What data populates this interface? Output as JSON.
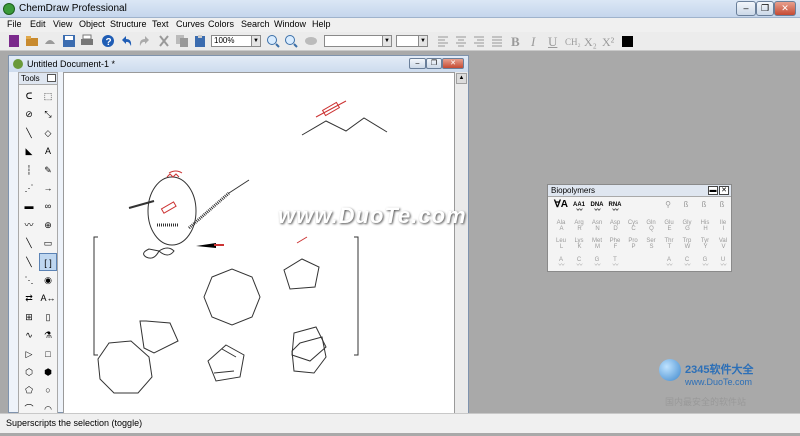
{
  "app": {
    "title": "ChemDraw Professional",
    "window_buttons": {
      "minimize": "–",
      "restore": "❐",
      "close": "✕"
    }
  },
  "menu": [
    "File",
    "Edit",
    "View",
    "Object",
    "Structure",
    "Text",
    "Curves",
    "Colors",
    "Search",
    "Window",
    "Help"
  ],
  "toolbar": {
    "zoom_value": "100%",
    "font_value": "",
    "size_value": "",
    "format": {
      "bold": "B",
      "italic": "I",
      "underline": "U",
      "formula": "CH₂",
      "subscript": "X₂",
      "superscript": "X²"
    },
    "color_swatch": "#000000"
  },
  "document": {
    "title": "Untitled Document-1 *",
    "buttons": {
      "minimize": "–",
      "restore": "❐",
      "close": "✕"
    }
  },
  "tools": {
    "header": "Tools",
    "items": [
      "lasso-icon",
      "marquee-icon",
      "structure-perspective-icon",
      "bond-chain-icon",
      "solid-bond-icon",
      "eraser-icon",
      "wedge-bond-icon",
      "text-icon",
      "dashed-bond-icon",
      "pen-icon",
      "hashed-bond-icon",
      "arrow-icon",
      "bold-bond-icon",
      "orbital-icon",
      "wavy-bond-icon",
      "chemical-symbol-icon",
      "bond-icon",
      "rectangle-icon",
      "bracket-icon",
      "bracket-selected-icon",
      "wedged-hash-icon",
      "stereo-icon",
      "reaction-icon",
      "atom-map-icon",
      "table-icon",
      "tlc-plate-icon",
      "curve-icon",
      "acid-base-icon",
      "play-icon",
      "square-icon",
      "cyclohexane-icon",
      "hexagon-icon",
      "pentagon-icon",
      "circle-icon",
      "cyclopentane-icon",
      "boat-icon",
      "pentagon-ring-icon",
      "benzene-icon"
    ],
    "selected_index": 19
  },
  "biopolymers": {
    "title": "Biopolymers",
    "header_buttons": {
      "minimize": "▬",
      "close": "✕"
    },
    "row0": [
      "AA1",
      "DNA",
      "RNA"
    ],
    "amino_acids": [
      [
        "Ala",
        "A"
      ],
      [
        "Arg",
        "R"
      ],
      [
        "Asn",
        "N"
      ],
      [
        "Asp",
        "D"
      ],
      [
        "Cys",
        "C"
      ],
      [
        "Gln",
        "Q"
      ],
      [
        "Glu",
        "E"
      ],
      [
        "Gly",
        "G"
      ],
      [
        "His",
        "H"
      ],
      [
        "Ile",
        "I"
      ],
      [
        "Leu",
        "L"
      ],
      [
        "Lys",
        "K"
      ],
      [
        "Met",
        "M"
      ],
      [
        "Phe",
        "F"
      ],
      [
        "Pro",
        "P"
      ],
      [
        "Ser",
        "S"
      ],
      [
        "Thr",
        "T"
      ],
      [
        "Trp",
        "W"
      ],
      [
        "Tyr",
        "Y"
      ],
      [
        "Val",
        "V"
      ]
    ],
    "dna_bases": [
      "A",
      "C",
      "G",
      "T"
    ],
    "rna_bases": [
      "A",
      "C",
      "G",
      "U"
    ]
  },
  "status_bar": {
    "text": "Superscripts the selection (toggle)"
  },
  "watermarks": {
    "center": "www.DuoTe.com",
    "logo_line1": "2345软件大全",
    "logo_line2": "www.DuoTe.com",
    "logo_line3": "国内最安全的软件站"
  }
}
